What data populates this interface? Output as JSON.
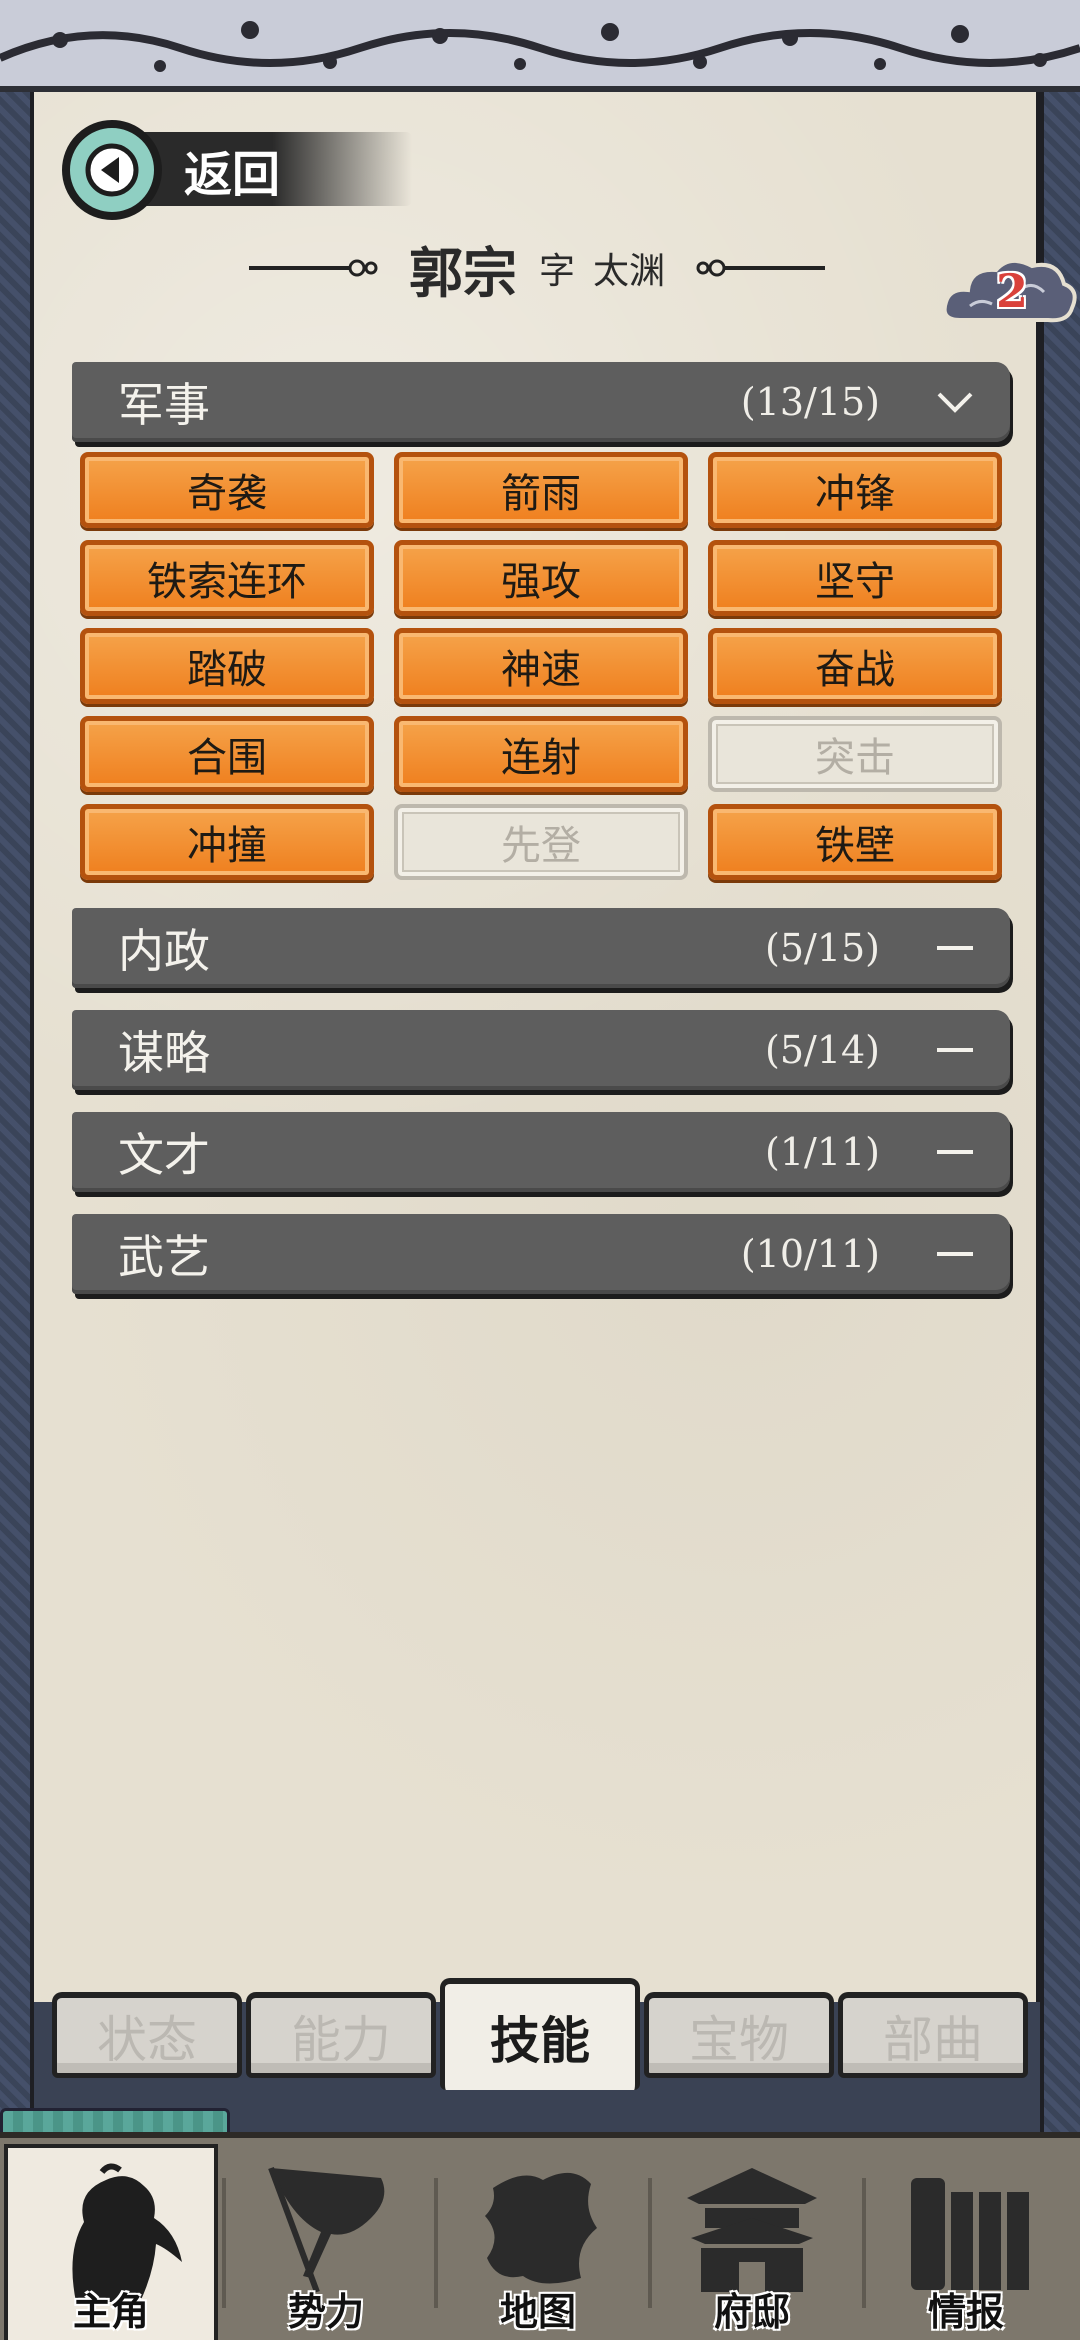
{
  "header": {
    "back_label": "返回",
    "name": "郭宗",
    "courtesy_prefix": "字",
    "courtesy_name": "太渊",
    "badge_count": "2"
  },
  "categories": [
    {
      "name": "军事",
      "count": "(13/15)",
      "expanded": true
    },
    {
      "name": "内政",
      "count": "(5/15)",
      "expanded": false
    },
    {
      "name": "谋略",
      "count": "(5/14)",
      "expanded": false
    },
    {
      "name": "文才",
      "count": "(1/11)",
      "expanded": false
    },
    {
      "name": "武艺",
      "count": "(10/11)",
      "expanded": false
    }
  ],
  "military_skills": [
    {
      "label": "奇袭",
      "learned": true
    },
    {
      "label": "箭雨",
      "learned": true
    },
    {
      "label": "冲锋",
      "learned": true
    },
    {
      "label": "铁索连环",
      "learned": true
    },
    {
      "label": "强攻",
      "learned": true
    },
    {
      "label": "坚守",
      "learned": true
    },
    {
      "label": "踏破",
      "learned": true
    },
    {
      "label": "神速",
      "learned": true
    },
    {
      "label": "奋战",
      "learned": true
    },
    {
      "label": "合围",
      "learned": true
    },
    {
      "label": "连射",
      "learned": true
    },
    {
      "label": "突击",
      "learned": false
    },
    {
      "label": "冲撞",
      "learned": true
    },
    {
      "label": "先登",
      "learned": false
    },
    {
      "label": "铁壁",
      "learned": true
    }
  ],
  "sub_tabs": [
    {
      "label": "状态",
      "active": false
    },
    {
      "label": "能力",
      "active": false
    },
    {
      "label": "技能",
      "active": true
    },
    {
      "label": "宝物",
      "active": false
    },
    {
      "label": "部曲",
      "active": false
    }
  ],
  "bottom_nav": [
    {
      "label": "主角",
      "icon": "warrior-icon",
      "active": true
    },
    {
      "label": "势力",
      "icon": "flag-icon",
      "active": false
    },
    {
      "label": "地图",
      "icon": "map-icon",
      "active": false
    },
    {
      "label": "府邸",
      "icon": "mansion-icon",
      "active": false
    },
    {
      "label": "情报",
      "icon": "scrolls-icon",
      "active": false
    }
  ],
  "colors": {
    "skill_learned": "#ef7f1e",
    "skill_locked": "#e9e5da",
    "category_bar": "#5e5e5e",
    "paper": "#e6e0d1",
    "back_button": "#8fcfc2"
  }
}
